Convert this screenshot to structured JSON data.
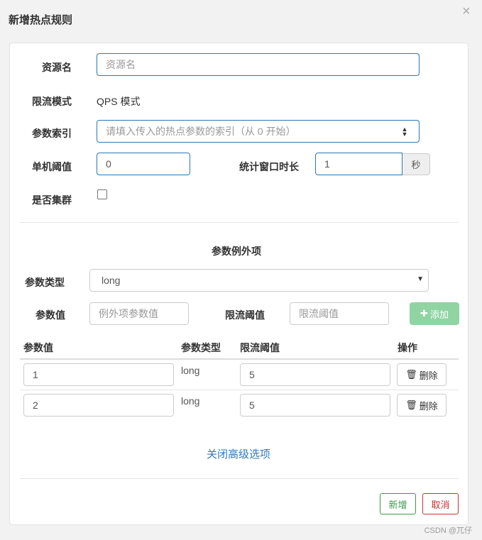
{
  "dialog": {
    "title": "新增热点规则"
  },
  "form": {
    "resource_label": "资源名",
    "resource_placeholder": "资源名",
    "mode_label": "限流模式",
    "mode_value": "QPS 模式",
    "index_label": "参数索引",
    "index_placeholder": "请填入传入的热点参数的索引（从 0 开始）",
    "threshold_label": "单机阈值",
    "threshold_value": "0",
    "window_label": "统计窗口时长",
    "window_value": "1",
    "window_unit": "秒",
    "cluster_label": "是否集群",
    "cluster_checked": false
  },
  "advanced": {
    "title": "参数例外项",
    "param_type_label": "参数类型",
    "param_type_selected": "long",
    "param_value_label": "参数值",
    "param_value_placeholder": "例外项参数值",
    "limit_label": "限流阈值",
    "limit_placeholder": "限流阈值",
    "add_label": "添加",
    "table": {
      "headers": [
        "参数值",
        "参数类型",
        "限流阈值",
        "操作"
      ],
      "rows": [
        {
          "value": "1",
          "type": "long",
          "limit": "5",
          "action": "删除"
        },
        {
          "value": "2",
          "type": "long",
          "limit": "5",
          "action": "删除"
        }
      ]
    },
    "close_link": "关闭高级选项"
  },
  "footer": {
    "ok_label": "新增",
    "cancel_label": "取消"
  },
  "watermark": "CSDN @兀仔",
  "colors": {
    "primary_border": "#2c78b5",
    "success": "#3c9a4a",
    "danger": "#c9302c",
    "link": "#337ab7",
    "add_button": "#90d4a3"
  }
}
